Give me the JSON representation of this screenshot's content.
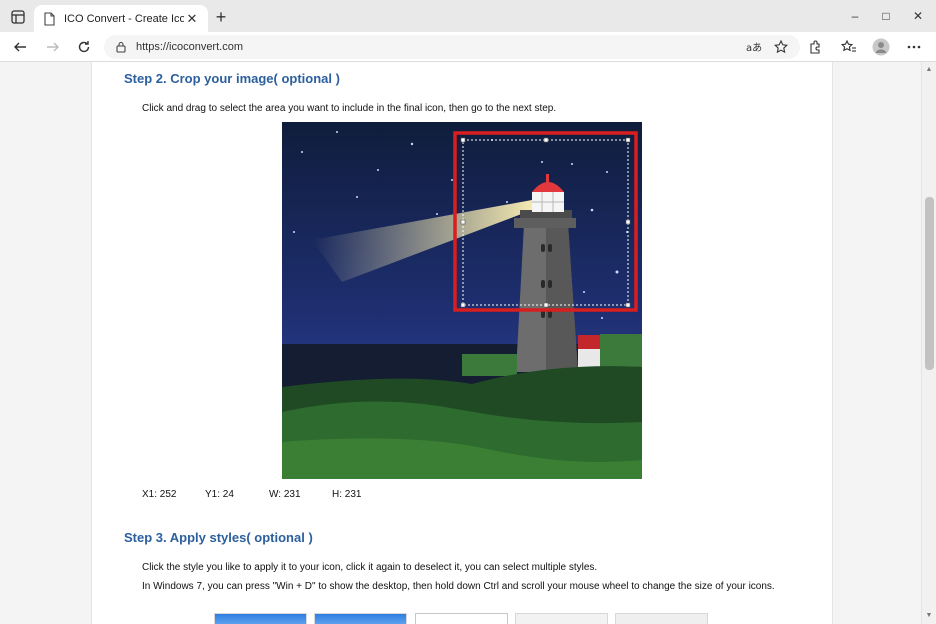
{
  "browser": {
    "tab_title": "ICO Convert - Create Icons From",
    "url": "https://icoconvert.com",
    "icons": {
      "tab_actions": "tab-actions-icon",
      "favicon": "page-icon",
      "close": "close-icon",
      "new_tab": "plus-icon",
      "back": "back-arrow-icon",
      "forward": "forward-arrow-icon",
      "refresh": "refresh-icon",
      "lock": "lock-icon",
      "read_aloud": "read-aloud-icon",
      "favorite": "add-favorite-icon",
      "extensions": "extensions-icon",
      "favorites": "favorites-icon",
      "profile": "profile-icon",
      "menu": "more-icon"
    },
    "window_controls": {
      "minimize": "–",
      "maximize": "□",
      "close": "✕"
    }
  },
  "page": {
    "step2": {
      "heading": "Step 2. Crop your image( optional )",
      "instruction": "Click and drag to select the area you want to include in the final icon, then go to the next step."
    },
    "coords": {
      "x1": "X1:  252",
      "y1": "Y1:  24",
      "w": "W:  231",
      "h": "H:  231"
    },
    "step3": {
      "heading": "Step 3. Apply styles( optional )",
      "line1": "Click the style you like to apply it to your icon, click it again to deselect it, you can select multiple styles.",
      "line2": "In Windows 7, you can press \"Win + D\" to show the desktop, then hold down Ctrl and scroll your mouse wheel to change the size of your icons."
    }
  },
  "colors": {
    "heading": "#2c5f9e",
    "crop_highlight": "#d81e1e",
    "sky_top": "#0f1d3c",
    "sky_bottom": "#2a3f8f"
  }
}
